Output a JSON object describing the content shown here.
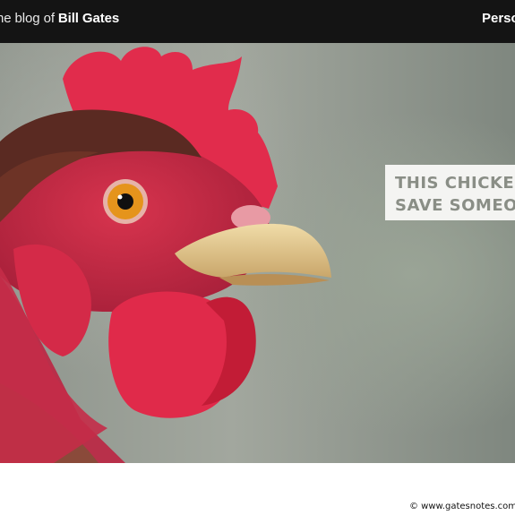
{
  "header": {
    "brand_prefix": "he blog of",
    "brand_name": "Bill Gates",
    "nav_personal": "Perso"
  },
  "hero": {
    "image_subject": "rooster-closeup",
    "caption_line1": "THIS CHICKE",
    "caption_line2": "SAVE SOMEO"
  },
  "footer": {
    "watermark": "© www.gatesnotes.com"
  },
  "colors": {
    "topbar": "#141414",
    "comb_red": "#e0284a",
    "beak": "#e2c58a",
    "caption_text": "#8a8e86"
  }
}
